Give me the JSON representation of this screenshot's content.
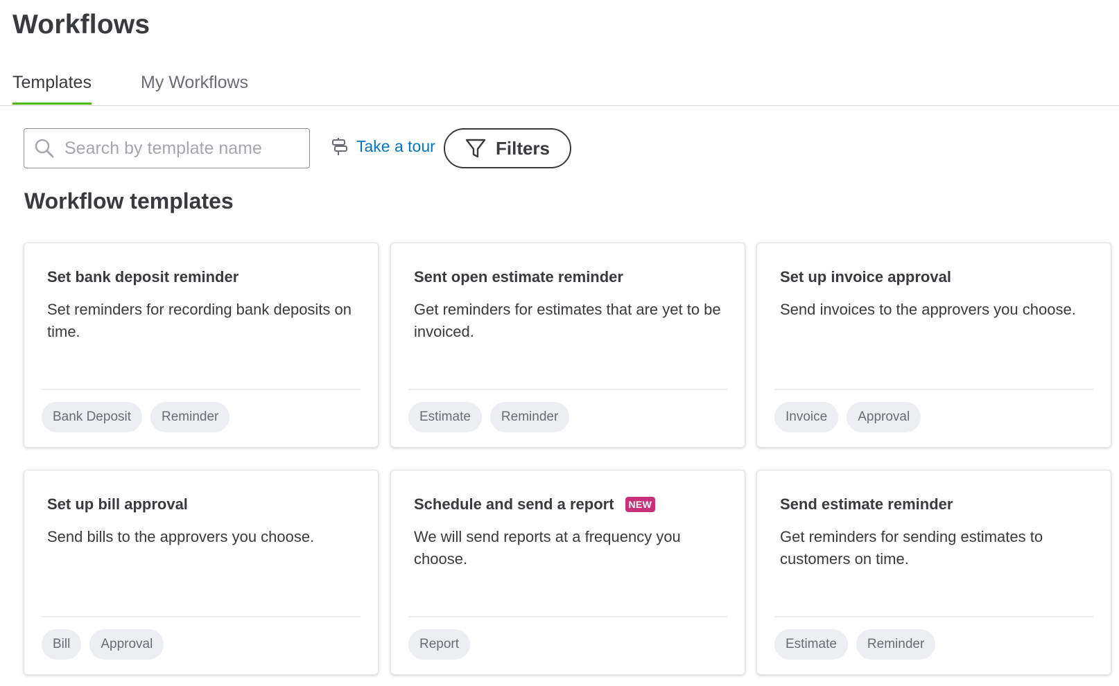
{
  "page": {
    "title": "Workflows"
  },
  "tabs": [
    {
      "label": "Templates",
      "active": true
    },
    {
      "label": "My Workflows",
      "active": false
    }
  ],
  "toolbar": {
    "search_placeholder": "Search by template name",
    "search_value": "",
    "tour_label": "Take a tour",
    "filters_label": "Filters"
  },
  "section": {
    "title": "Workflow templates"
  },
  "colors": {
    "accent_green": "#53b700",
    "link_blue": "#0077c5",
    "new_badge": "#c9307c"
  },
  "cards": [
    {
      "title": "Set bank deposit reminder",
      "badge": null,
      "description": "Set reminders for recording bank deposits on time.",
      "tags": [
        "Bank Deposit",
        "Reminder"
      ]
    },
    {
      "title": "Sent open estimate reminder",
      "badge": null,
      "description": "Get reminders for estimates that are yet to be invoiced.",
      "tags": [
        "Estimate",
        "Reminder"
      ]
    },
    {
      "title": "Set up invoice approval",
      "badge": null,
      "description": "Send invoices to the approvers you choose.",
      "tags": [
        "Invoice",
        "Approval"
      ]
    },
    {
      "title": "Set up bill approval",
      "badge": null,
      "description": "Send bills to the approvers you choose.",
      "tags": [
        "Bill",
        "Approval"
      ]
    },
    {
      "title": "Schedule and send a report",
      "badge": "NEW",
      "description": "We will send reports at a frequency you choose.",
      "tags": [
        "Report"
      ]
    },
    {
      "title": "Send estimate reminder",
      "badge": null,
      "description": "Get reminders for sending estimates to customers on time.",
      "tags": [
        "Estimate",
        "Reminder"
      ]
    }
  ]
}
